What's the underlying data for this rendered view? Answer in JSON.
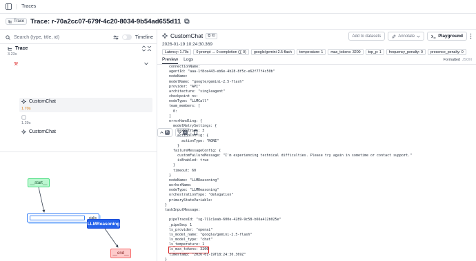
{
  "topbar": {
    "breadcrumb": "Traces"
  },
  "header": {
    "badge": "Trace",
    "title": "Trace: r-70a2cc07-679f-4c20-8034-9b54ad655d11",
    "prev_key": "K",
    "next_key": "J"
  },
  "left": {
    "search_placeholder": "Search (type, title, id)",
    "timeline_label": "Timeline",
    "tree": {
      "root_label": "Trace",
      "root_duration": "3.23s",
      "items": [
        {
          "label": "CustomChat",
          "duration": "1.70s"
        },
        {
          "label": "",
          "duration": "1.29s"
        },
        {
          "label": "CustomChat",
          "duration": ""
        }
      ]
    },
    "graph": {
      "start": "__start__",
      "agent_text": "cialis",
      "llm": "LLMReasoning",
      "end": "__end__"
    }
  },
  "right": {
    "title": "CustomChat",
    "id_label": "ID",
    "add_to_datasets": "Add to datasets",
    "annotate": "Annotate",
    "playground": "Playground",
    "timestamp": "2026-01-19 10:24:30.369",
    "chips": [
      "Latency: 1.70s",
      "0 prompt → 0 completion (∑ 0)",
      "google/gemini-2.5-flash",
      "temperature: 1",
      "max_tokens: 3200",
      "top_p: 1",
      "frequency_penalty: 0",
      "presence_penalty: 0"
    ],
    "tabs": [
      "Preview",
      "Logs"
    ],
    "view_formatted": "Formatted",
    "view_json": "JSON",
    "code_lines": [
      "  connectionName:",
      "  agentId: \"aaa-1f8ce443-eb6e-4b28-8f5c-e62f77f4c50b\"",
      "  nodeName:",
      "  modelName: \"google/gemini-2.5-flash\"",
      "  provider: \"API\"",
      "  architecture: \"singleagent\"",
      "  checkpoint_ns:",
      "  nodeType: \"LLMCall\"",
      "  team_members: [",
      "    0:",
      "  ]",
      "  errorHandling: {",
      "    modelRetrySettings: {",
      "      maxRetries: 3",
      "      actionConfig: {",
      "        actionType: \"NONE\"",
      "      }",
      "    failureMessageConfig: {",
      "      customFailureMessage: \"I'm experiencing technical difficulties. Please try again in sometime or contact support.\"",
      "      isEnabled: true",
      "    }",
      "    timeout: 60",
      "  }",
      "  nodeName: \"LLMReasoning\"",
      "  workerName:",
      "  nodeType: \"LLMReasoning\"",
      "  orchestrationType: \"delegation\"",
      "  primaryStateVariable:",
      "}",
      "taskInputMessage:",
      "",
      "  pipeTraceId: \"sg-711c1eab-600e-4289-9c58-b66a412b025e\"",
      "  _pipeSeq: 1",
      "  ls_provider: \"openai\"",
      "  ls_model_name: \"google/gemini-2.5-flash\"",
      "  ls_model_type: \"chat\"",
      "  ls_temperature: 1",
      "  ls_max_tokens: 3200",
      "  timestamp: \"2026-01-19T18:24:30.369Z\"",
      "}"
    ],
    "highlight_line_index": 37
  },
  "colors": {
    "accent_blue": "#2563eb",
    "start_green": "#bbf7d0",
    "end_red": "#fecaca",
    "highlight_red": "#dc2626"
  }
}
